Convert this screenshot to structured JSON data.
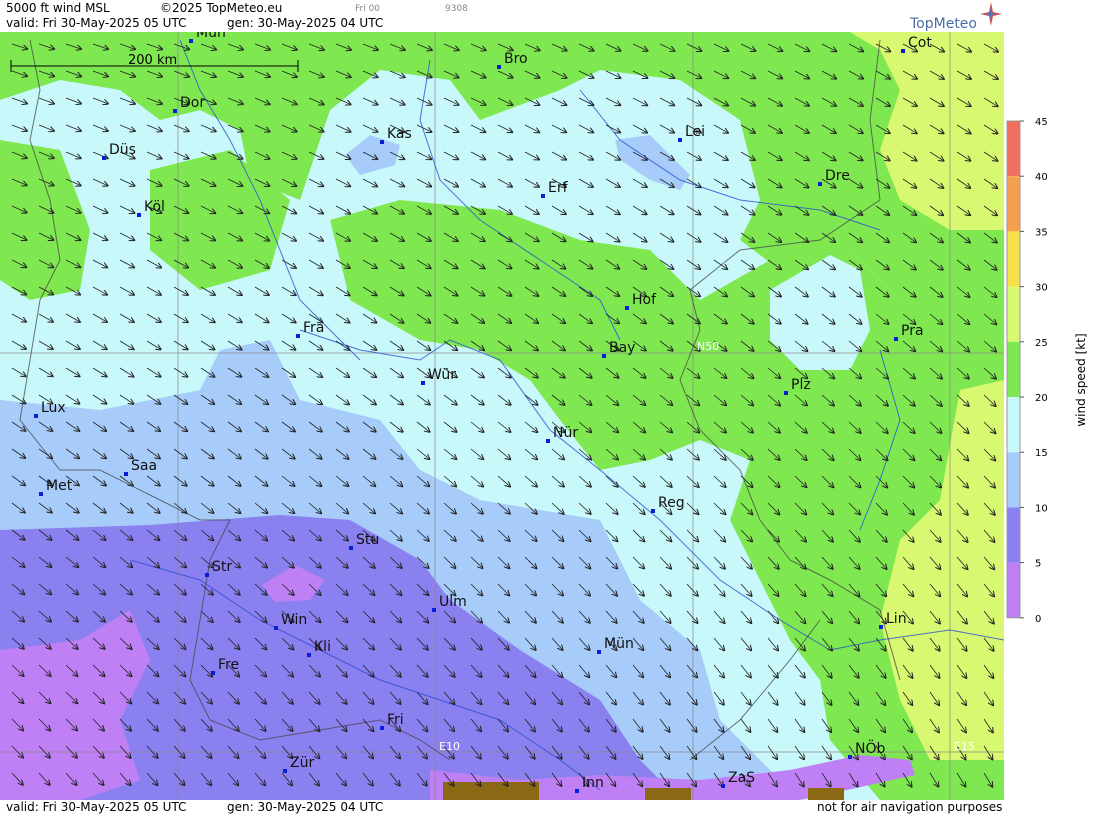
{
  "header": {
    "product": "5000 ft wind MSL",
    "copyright": "©2025 TopMeteo.eu",
    "step": "Fri 00",
    "code": "9308",
    "valid": "valid:  Fri  30-May-2025  05 UTC",
    "gen": "gen: 30-May-2025 04 UTC",
    "logo": "TopMeteo"
  },
  "footer": {
    "valid": "valid:  Fri  30-May-2025  05 UTC",
    "gen": "gen: 30-May-2025 04 UTC",
    "disclaimer": "not for air navigation purposes"
  },
  "scale_bar": {
    "label": "200 km"
  },
  "grid_labels": {
    "lat": "N50",
    "lon1": "E10",
    "lon2": "E15"
  },
  "legend": {
    "title": "wind speed [kt]",
    "ticks": [
      "45",
      "40",
      "35",
      "30",
      "25",
      "20",
      "15",
      "10",
      "5",
      "0"
    ],
    "colors": [
      "#f07060",
      "#f5a050",
      "#f5e04a",
      "#d7f870",
      "#7fe850",
      "#c8f8fa",
      "#a7ccfa",
      "#8a80f0",
      "#c080f5"
    ]
  },
  "cities": [
    {
      "name": "Mün"
    },
    {
      "name": "Bro"
    },
    {
      "name": "Cot"
    },
    {
      "name": "Dor"
    },
    {
      "name": "Kas"
    },
    {
      "name": "Lei"
    },
    {
      "name": "Düs"
    },
    {
      "name": "Dre"
    },
    {
      "name": "Erf"
    },
    {
      "name": "Köl"
    },
    {
      "name": "Hof"
    },
    {
      "name": "Fra"
    },
    {
      "name": "Pra"
    },
    {
      "name": "Bay"
    },
    {
      "name": "Wür"
    },
    {
      "name": "Plz"
    },
    {
      "name": "Lux"
    },
    {
      "name": "Nür"
    },
    {
      "name": "Saa"
    },
    {
      "name": "Met"
    },
    {
      "name": "Reg"
    },
    {
      "name": "Stu"
    },
    {
      "name": "Str"
    },
    {
      "name": "Ulm"
    },
    {
      "name": "Win"
    },
    {
      "name": "Lin"
    },
    {
      "name": "Kli"
    },
    {
      "name": "Mün"
    },
    {
      "name": "Fre"
    },
    {
      "name": "Fri"
    },
    {
      "name": "NÖb"
    },
    {
      "name": "Zür"
    },
    {
      "name": "ZaS"
    },
    {
      "name": "Inn"
    }
  ]
}
